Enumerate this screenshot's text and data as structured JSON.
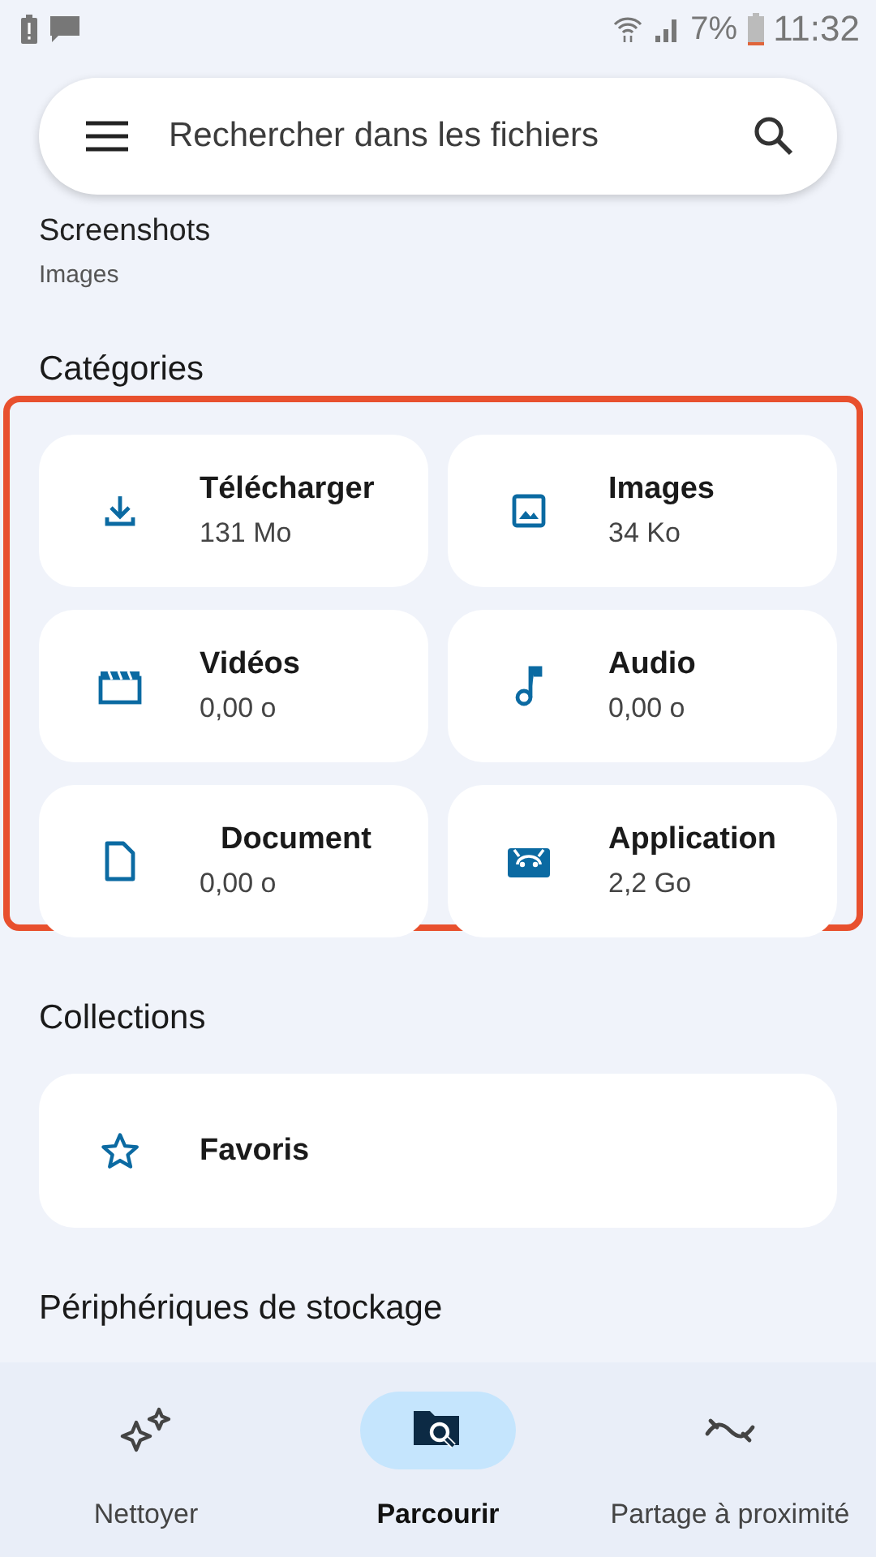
{
  "status_bar": {
    "battery_percent": "7%",
    "time": "11:32"
  },
  "search": {
    "placeholder": "Rechercher dans les fichiers"
  },
  "recent": {
    "title": "Screenshots",
    "subtitle": "Images"
  },
  "categories": {
    "title": "Catégories",
    "items": [
      {
        "kind": "download",
        "name": "Télécharger",
        "size": "131 Mo"
      },
      {
        "kind": "image",
        "name": "Images",
        "size": "34 Ko"
      },
      {
        "kind": "video",
        "name": "Vidéos",
        "size": "0,00 o"
      },
      {
        "kind": "audio",
        "name": "Audio",
        "size": "0,00 o"
      },
      {
        "kind": "document",
        "name": "Document",
        "size": "0,00 o"
      },
      {
        "kind": "app",
        "name": "Application",
        "size": "2,2 Go"
      }
    ]
  },
  "collections": {
    "title": "Collections",
    "items": [
      {
        "kind": "star",
        "name": "Favoris"
      }
    ]
  },
  "storage": {
    "title": "Périphériques de stockage"
  },
  "bottom_nav": [
    {
      "kind": "clean",
      "label": "Nettoyer",
      "selected": false
    },
    {
      "kind": "browse",
      "label": "Parcourir",
      "selected": true
    },
    {
      "kind": "share",
      "label": "Partage à proximité",
      "selected": false
    }
  ]
}
